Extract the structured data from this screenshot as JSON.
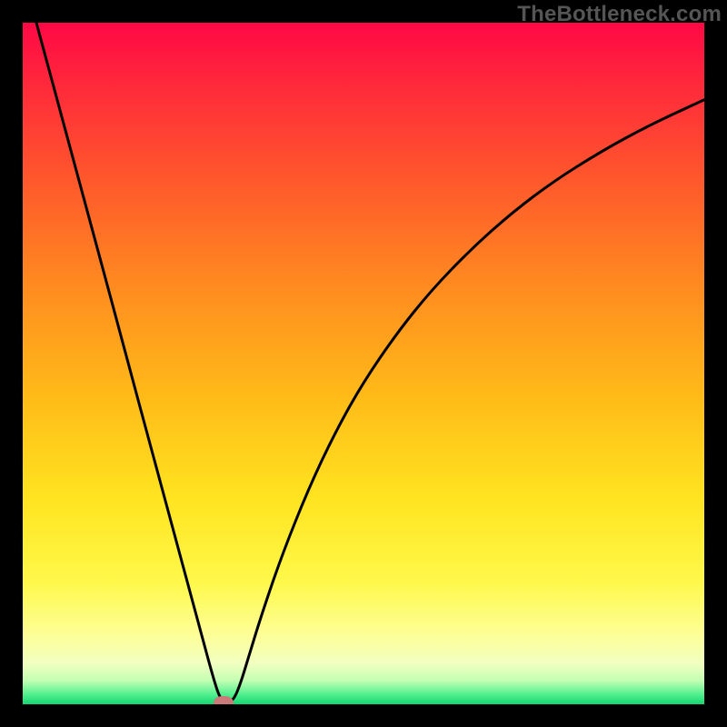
{
  "watermark": "TheBottleneck.com",
  "chart_data": {
    "type": "line",
    "title": "",
    "xlabel": "",
    "ylabel": "",
    "xlim": [
      0,
      100
    ],
    "ylim": [
      0,
      100
    ],
    "grid": false,
    "series": [
      {
        "name": "bottleneck-curve",
        "x": [
          2,
          4,
          6,
          8,
          10,
          12,
          14,
          16,
          18,
          20,
          22,
          24,
          26,
          28,
          29,
          30,
          31,
          32,
          33,
          35,
          38,
          42,
          46,
          50,
          55,
          60,
          66,
          72,
          78,
          85,
          92,
          100
        ],
        "values": [
          100,
          92.6,
          85.2,
          77.8,
          70.4,
          63.0,
          55.6,
          48.1,
          40.7,
          33.3,
          25.9,
          18.5,
          11.1,
          3.7,
          0.7,
          0.2,
          0.7,
          3.2,
          6.5,
          13.0,
          21.8,
          31.8,
          40.2,
          47.3,
          54.6,
          60.8,
          67.0,
          72.3,
          76.8,
          81.2,
          85.0,
          88.7
        ]
      }
    ],
    "marker": {
      "x": 29.5,
      "y": 0.3
    },
    "background_gradient": {
      "stops": [
        {
          "offset": 0.0,
          "color": "#ff0845"
        },
        {
          "offset": 0.1,
          "color": "#ff2c3a"
        },
        {
          "offset": 0.25,
          "color": "#ff5e2a"
        },
        {
          "offset": 0.4,
          "color": "#ff8f1f"
        },
        {
          "offset": 0.55,
          "color": "#ffbb18"
        },
        {
          "offset": 0.7,
          "color": "#ffe420"
        },
        {
          "offset": 0.82,
          "color": "#fff84a"
        },
        {
          "offset": 0.9,
          "color": "#fdff99"
        },
        {
          "offset": 0.94,
          "color": "#f1ffc0"
        },
        {
          "offset": 0.965,
          "color": "#c4ffb4"
        },
        {
          "offset": 0.985,
          "color": "#55f08f"
        },
        {
          "offset": 1.0,
          "color": "#14d672"
        }
      ]
    }
  }
}
